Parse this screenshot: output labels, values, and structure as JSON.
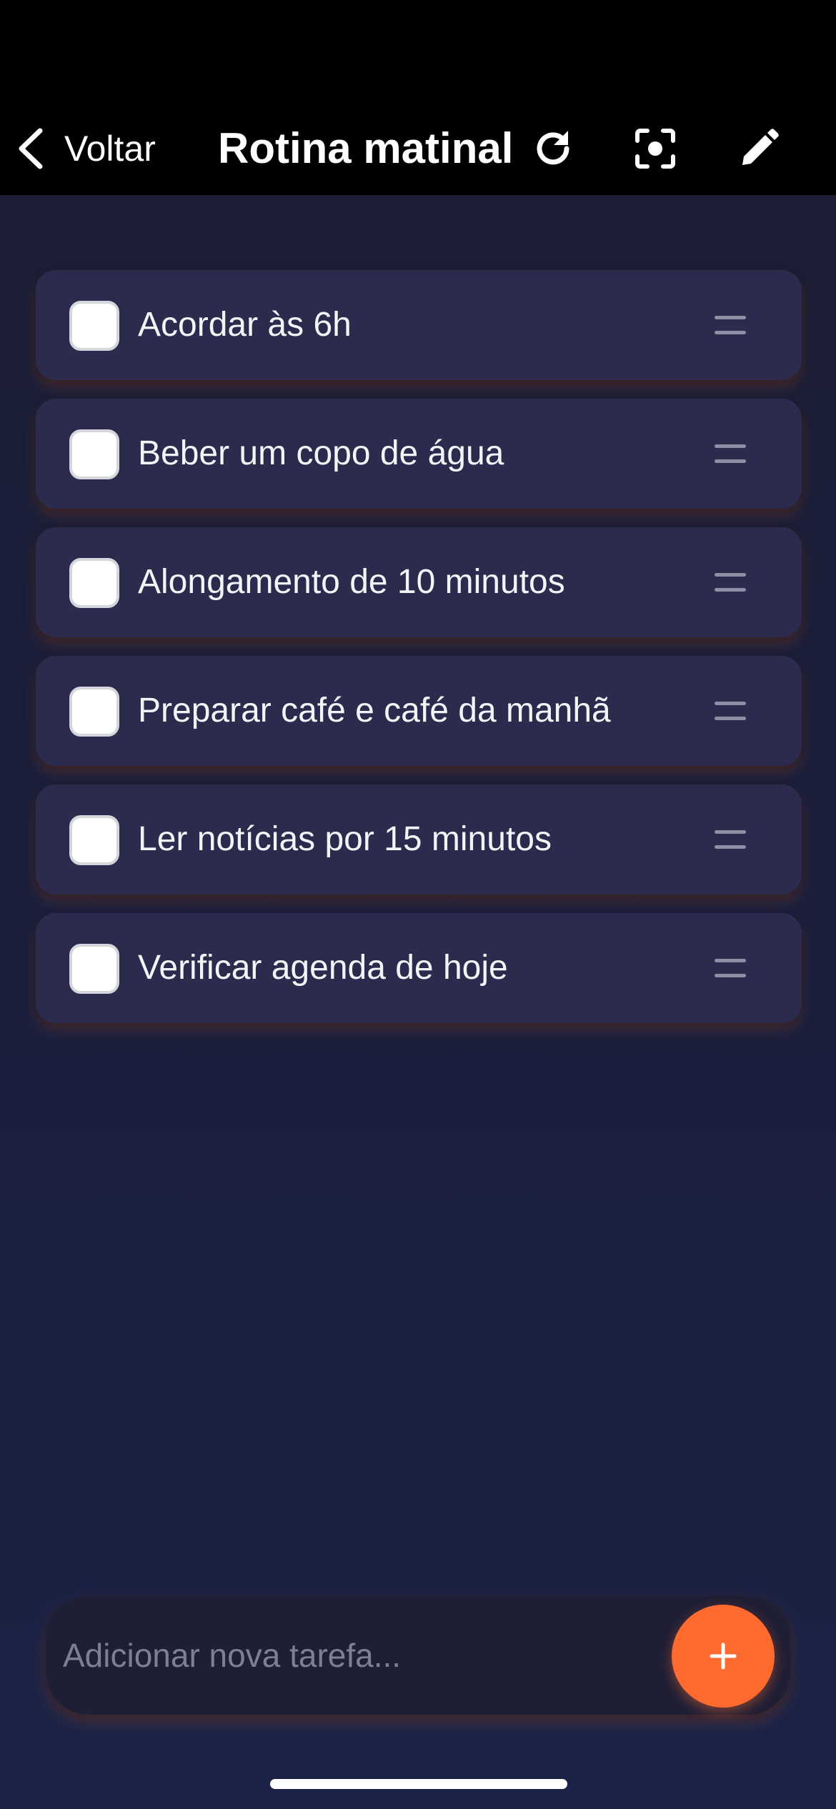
{
  "nav": {
    "back_label": "Voltar",
    "title": "Rotina matinal",
    "icons": [
      "chevron-left-icon",
      "refresh-icon",
      "focus-icon",
      "edit-icon"
    ]
  },
  "tasks": [
    {
      "label": "Acordar às 6h",
      "checked": false
    },
    {
      "label": "Beber um copo de água",
      "checked": false
    },
    {
      "label": "Alongamento de 10 minutos",
      "checked": false
    },
    {
      "label": "Preparar café e café da manhã",
      "checked": false
    },
    {
      "label": "Ler notícias por 15 minutos",
      "checked": false
    },
    {
      "label": "Verificar agenda de hoje",
      "checked": false
    }
  ],
  "composer": {
    "placeholder": "Adicionar nova tarefa...",
    "value": "",
    "add_icon": "plus-icon"
  },
  "colors": {
    "accent": "#ff6a2f",
    "card": "#2a2b4d",
    "background": "#1a1f3d"
  }
}
